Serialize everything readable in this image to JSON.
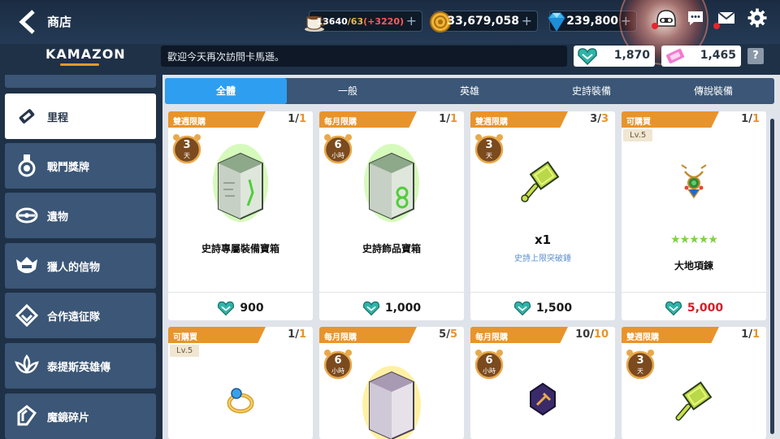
{
  "header": {
    "title": "商店",
    "stamina": {
      "current": "13640",
      "max": "/63",
      "extra": "(+3220)"
    },
    "gold": "33,679,058",
    "gems": "239,800"
  },
  "sub_header": {
    "logo": "KAMAZON",
    "marquee": "歡迎今天再次訪問卡馬遜。",
    "currency_a": "1,870",
    "currency_b": "1,465",
    "help": "?"
  },
  "sidebar": {
    "items": [
      {
        "label": "里程",
        "icon": "ticket-icon"
      },
      {
        "label": "戰鬥獎牌",
        "icon": "medal-icon"
      },
      {
        "label": "遺物",
        "icon": "relic-icon"
      },
      {
        "label": "獵人的信物",
        "icon": "helmet-icon"
      },
      {
        "label": "合作遠征隊",
        "icon": "coop-icon"
      },
      {
        "label": "泰提斯英雄傳",
        "icon": "lotus-icon"
      },
      {
        "label": "魔鏡碎片",
        "icon": "mirror-shard-icon"
      }
    ]
  },
  "tabs": [
    "全體",
    "一般",
    "英雄",
    "史詩裝備",
    "傳說裝備"
  ],
  "cards": [
    {
      "tag": "雙週限購",
      "count_cur": "1/",
      "count_max": "1",
      "timer_num": "3",
      "timer_unit": "天",
      "name": "史詩專屬裝備寶箱",
      "price": "900"
    },
    {
      "tag": "每月限購",
      "count_cur": "1/",
      "count_max": "1",
      "timer_num": "6",
      "timer_unit": "小時",
      "name": "史詩飾品寶箱",
      "price": "1,000"
    },
    {
      "tag": "雙週限購",
      "count_cur": "3/",
      "count_max": "3",
      "timer_num": "3",
      "timer_unit": "天",
      "qty": "x1",
      "sub": "史詩上限突破錘",
      "price": "1,500"
    },
    {
      "tag": "可購買",
      "count_cur": "1/",
      "count_max": "1",
      "level": "Lv.5",
      "stars": "★★★★★",
      "name": "大地項鍊",
      "price": "5,000"
    },
    {
      "tag": "可購買",
      "count_cur": "1/",
      "count_max": "1",
      "level": "Lv.5"
    },
    {
      "tag": "每月限購",
      "count_cur": "5/",
      "count_max": "5",
      "timer_num": "6",
      "timer_unit": "小時"
    },
    {
      "tag": "每月限購",
      "count_cur": "10/",
      "count_max": "10",
      "timer_num": "6",
      "timer_unit": "小時"
    },
    {
      "tag": "雙週限購",
      "count_cur": "1/",
      "count_max": "1",
      "timer_num": "3",
      "timer_unit": "天"
    }
  ],
  "colors": {
    "accent_orange": "#e8942c",
    "tab_active": "#2e9ff0",
    "sidebar_bg": "#3b5676",
    "price_red": "#d0202a"
  }
}
